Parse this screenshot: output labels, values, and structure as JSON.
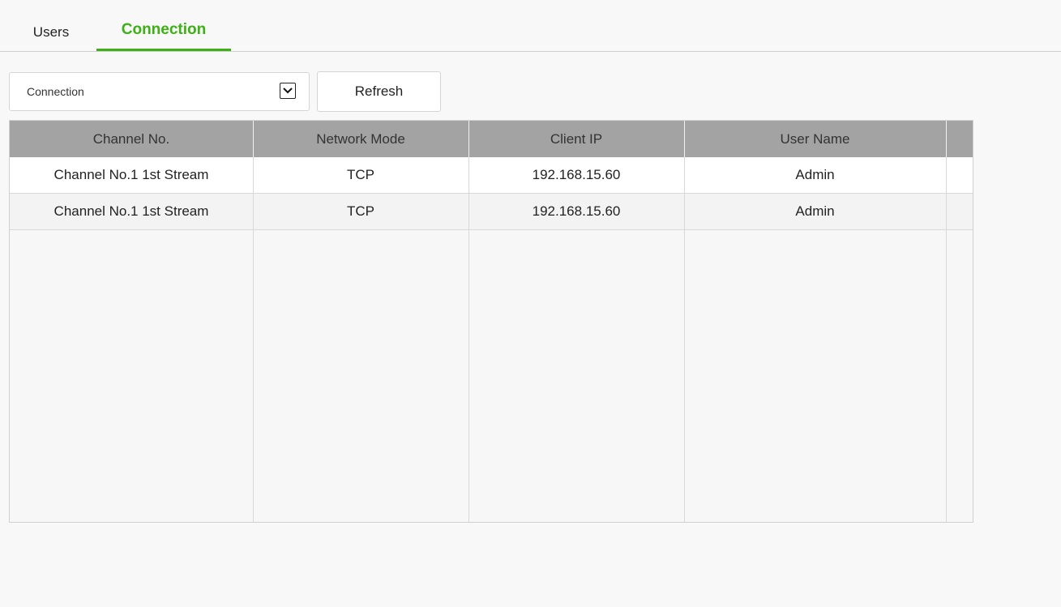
{
  "tabs": [
    {
      "label": "Users",
      "active": false
    },
    {
      "label": "Connection",
      "active": true
    }
  ],
  "toolbar": {
    "select_value": "Connection",
    "refresh_label": "Refresh"
  },
  "table": {
    "columns": [
      "Channel No.",
      "Network Mode",
      "Client IP",
      "User Name"
    ],
    "rows": [
      [
        "Channel No.1 1st Stream",
        "TCP",
        "192.168.15.60",
        "Admin"
      ],
      [
        "Channel No.1 1st Stream",
        "TCP",
        "192.168.15.60",
        "Admin"
      ]
    ]
  },
  "colors": {
    "accent": "#3cb014",
    "header_bg": "#a3a3a3"
  }
}
